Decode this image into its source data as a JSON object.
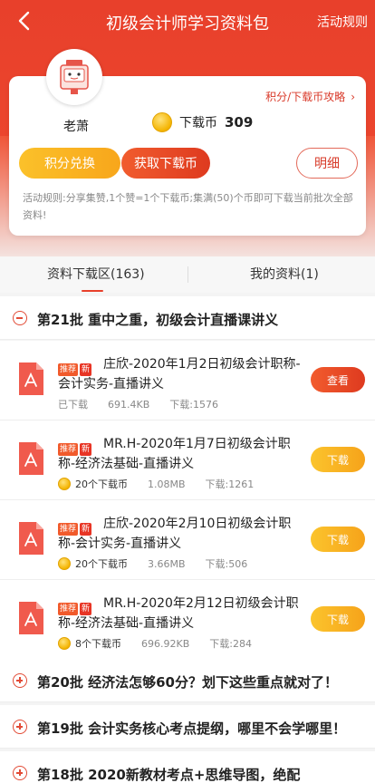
{
  "header": {
    "title": "初级会计师学习资料包",
    "rules_label": "活动规则"
  },
  "user": {
    "name": "老萧",
    "coins_label": "下载币",
    "coins": "309",
    "strategy_label": "积分/下载币攻略"
  },
  "buttons": {
    "exchange": "积分兑换",
    "get_coins": "获取下载币",
    "detail": "明细"
  },
  "activity_text": "活动规则:分享集赞,1个赞=1个下载币;集满(50)个币即可下载当前批次全部资料!",
  "tabs": [
    {
      "label": "资料下载区(163)"
    },
    {
      "label": "我的资料(1)"
    }
  ],
  "sections": [
    {
      "title": "第21批 重中之重，初级会计直播课讲义"
    },
    {
      "title": "第20批 经济法怎够60分？划下这些重点就对了！"
    },
    {
      "title": "第19批 会计实务核心考点提纲，哪里不会学哪里！"
    },
    {
      "title": "第18批 2020新教材考点+思维导图，绝配"
    }
  ],
  "tags": {
    "recommend": "推荐",
    "new": "新"
  },
  "items": [
    {
      "title": "庄欣-2020年1月2日初级会计职称-会计实务-直播讲义",
      "status": "已下载",
      "size": "691.4KB",
      "downloads": "下载:1576",
      "action": "查看"
    },
    {
      "title": "MR.H-2020年1月7日初级会计职称-经济法基础-直播讲义",
      "price": "20个下载币",
      "size": "1.08MB",
      "downloads": "下载:1261",
      "action": "下载"
    },
    {
      "title": "庄欣-2020年2月10日初级会计职称-会计实务-直播讲义",
      "price": "20个下载币",
      "size": "3.66MB",
      "downloads": "下载:506",
      "action": "下载"
    },
    {
      "title": "MR.H-2020年2月12日初级会计职称-经济法基础-直播讲义",
      "price": "8个下载币",
      "size": "696.92KB",
      "downloads": "下载:284",
      "action": "下载"
    }
  ]
}
